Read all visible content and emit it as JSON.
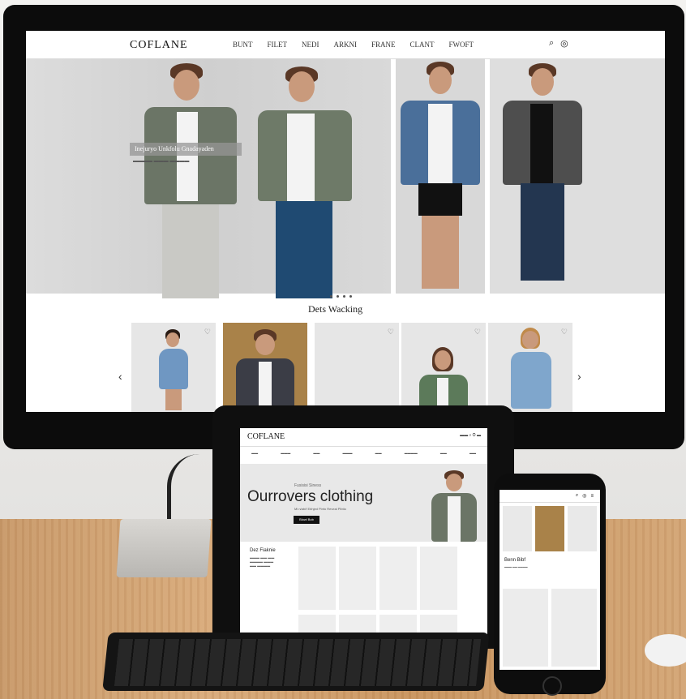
{
  "desktop": {
    "logo": "COFLANE",
    "menu": [
      "BUNT",
      "FILET",
      "NEDI",
      "ARKNI",
      "FRANE",
      "CLANT",
      "FWOFT"
    ],
    "hero_overlay_text": "Inejuryo Unkfolu Gnadayaden",
    "section_title": "Dets Wacking",
    "prev_arrow": "‹",
    "next_arrow": "›",
    "icons": [
      "search-icon",
      "bag-icon",
      "heart-icon"
    ]
  },
  "tablet": {
    "logo": "COFLANE",
    "hero_small": "Fusisisi Siness",
    "headline": "Ourrovers clothing",
    "hero_sub": "Mi n/ab/f Ebhjed Pinfo Reveal Plbtio",
    "button_label": "Blowl Bob",
    "left_title": "Dez Fiaknie"
  },
  "phone": {
    "title": "Benn Bibf"
  },
  "colors": {
    "frame": "#0c0c0c",
    "desk": "#d1a170",
    "wall": "#ecebe9",
    "accent": "#111111"
  }
}
